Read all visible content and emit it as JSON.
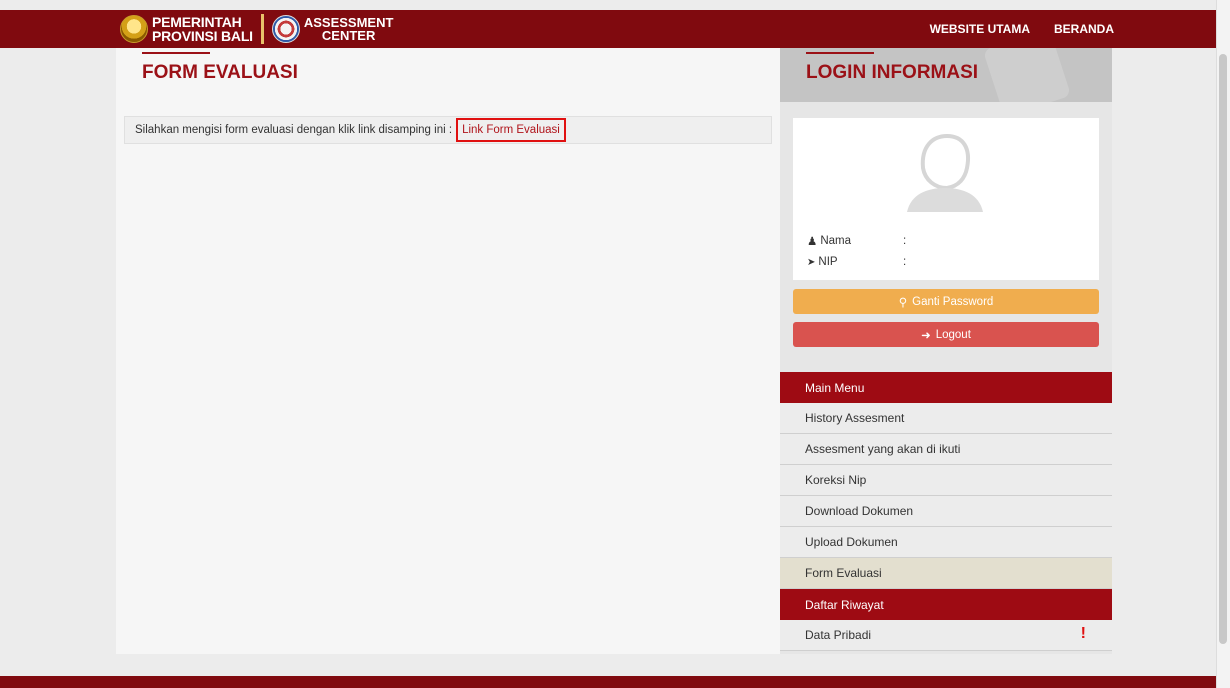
{
  "header": {
    "logo_line1": "PEMERINTAH",
    "logo_line2": "PROVINSI BALI",
    "logo2_line1": "ASSESSMENT",
    "logo2_line2": "CENTER",
    "nav": [
      "WEBSITE UTAMA",
      "BERANDA"
    ]
  },
  "main": {
    "title": "FORM EVALUASI",
    "instruction": "Silahkan mengisi form evaluasi dengan klik link disamping ini :",
    "link_text": "Link Form Evaluasi"
  },
  "sidebar": {
    "title": "LOGIN INFORMASI",
    "profile": {
      "nama_label": "Nama",
      "nip_label": "NIP",
      "sep": ":"
    },
    "ganti_password": "Ganti Password",
    "logout": "Logout",
    "main_menu_label": "Main Menu",
    "main_menu": [
      "History Assesment",
      "Assesment yang akan di ikuti",
      "Koreksi Nip",
      "Download Dokumen",
      "Upload Dokumen",
      "Form Evaluasi"
    ],
    "riwayat_label": "Daftar Riwayat",
    "riwayat": [
      "Data Pribadi"
    ],
    "alert_mark": "!"
  },
  "colors": {
    "brand": "#800a0f",
    "accent": "#9b1117",
    "warning": "#f0ad4e",
    "danger": "#d9534f"
  }
}
